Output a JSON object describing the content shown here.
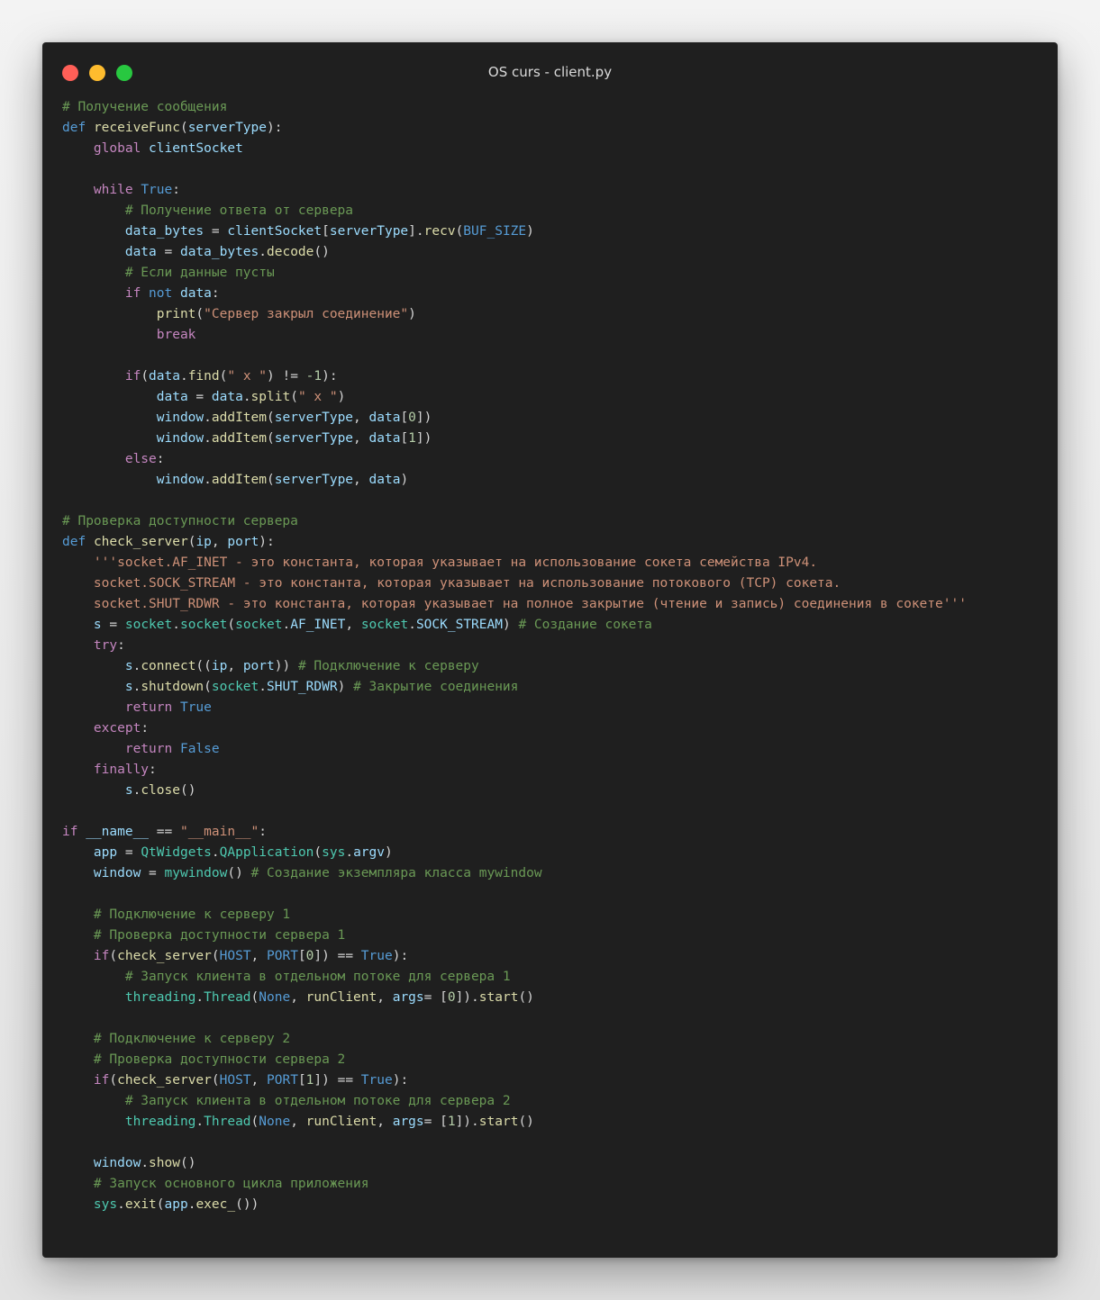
{
  "window": {
    "title": "OS curs - client.py",
    "controls": [
      "close",
      "minimize",
      "maximize"
    ]
  },
  "editor": {
    "language": "python",
    "lines": [
      [
        [
          "com",
          "# Получение сообщения"
        ]
      ],
      [
        [
          "def",
          "def"
        ],
        [
          "plain",
          " "
        ],
        [
          "fn",
          "receiveFunc"
        ],
        [
          "plain",
          "("
        ],
        [
          "var",
          "serverType"
        ],
        [
          "plain",
          "):"
        ]
      ],
      [
        [
          "plain",
          "    "
        ],
        [
          "kw",
          "global"
        ],
        [
          "plain",
          " "
        ],
        [
          "var",
          "clientSocket"
        ]
      ],
      [],
      [
        [
          "plain",
          "    "
        ],
        [
          "kw",
          "while"
        ],
        [
          "plain",
          " "
        ],
        [
          "const",
          "True"
        ],
        [
          "plain",
          ":"
        ]
      ],
      [
        [
          "plain",
          "        "
        ],
        [
          "com",
          "# Получение ответа от сервера"
        ]
      ],
      [
        [
          "plain",
          "        "
        ],
        [
          "var",
          "data_bytes"
        ],
        [
          "plain",
          " = "
        ],
        [
          "var",
          "clientSocket"
        ],
        [
          "plain",
          "["
        ],
        [
          "var",
          "serverType"
        ],
        [
          "plain",
          "]."
        ],
        [
          "fn",
          "recv"
        ],
        [
          "plain",
          "("
        ],
        [
          "const",
          "BUF_SIZE"
        ],
        [
          "plain",
          ")"
        ]
      ],
      [
        [
          "plain",
          "        "
        ],
        [
          "var",
          "data"
        ],
        [
          "plain",
          " = "
        ],
        [
          "var",
          "data_bytes"
        ],
        [
          "plain",
          "."
        ],
        [
          "fn",
          "decode"
        ],
        [
          "plain",
          "()"
        ]
      ],
      [
        [
          "plain",
          "        "
        ],
        [
          "com",
          "# Если данные пусты"
        ]
      ],
      [
        [
          "plain",
          "        "
        ],
        [
          "kw",
          "if"
        ],
        [
          "plain",
          " "
        ],
        [
          "def",
          "not"
        ],
        [
          "plain",
          " "
        ],
        [
          "var",
          "data"
        ],
        [
          "plain",
          ":"
        ]
      ],
      [
        [
          "plain",
          "            "
        ],
        [
          "fn",
          "print"
        ],
        [
          "plain",
          "("
        ],
        [
          "str",
          "\"Сервер закрыл соединение\""
        ],
        [
          "plain",
          ")"
        ]
      ],
      [
        [
          "plain",
          "            "
        ],
        [
          "kw",
          "break"
        ]
      ],
      [],
      [
        [
          "plain",
          "        "
        ],
        [
          "kw",
          "if"
        ],
        [
          "plain",
          "("
        ],
        [
          "var",
          "data"
        ],
        [
          "plain",
          "."
        ],
        [
          "fn",
          "find"
        ],
        [
          "plain",
          "("
        ],
        [
          "str",
          "\" x \""
        ],
        [
          "plain",
          ") != "
        ],
        [
          "num",
          "-1"
        ],
        [
          "plain",
          "):"
        ]
      ],
      [
        [
          "plain",
          "            "
        ],
        [
          "var",
          "data"
        ],
        [
          "plain",
          " = "
        ],
        [
          "var",
          "data"
        ],
        [
          "plain",
          "."
        ],
        [
          "fn",
          "split"
        ],
        [
          "plain",
          "("
        ],
        [
          "str",
          "\" x \""
        ],
        [
          "plain",
          ")"
        ]
      ],
      [
        [
          "plain",
          "            "
        ],
        [
          "var",
          "window"
        ],
        [
          "plain",
          "."
        ],
        [
          "fn",
          "addItem"
        ],
        [
          "plain",
          "("
        ],
        [
          "var",
          "serverType"
        ],
        [
          "plain",
          ", "
        ],
        [
          "var",
          "data"
        ],
        [
          "plain",
          "["
        ],
        [
          "num",
          "0"
        ],
        [
          "plain",
          "])"
        ]
      ],
      [
        [
          "plain",
          "            "
        ],
        [
          "var",
          "window"
        ],
        [
          "plain",
          "."
        ],
        [
          "fn",
          "addItem"
        ],
        [
          "plain",
          "("
        ],
        [
          "var",
          "serverType"
        ],
        [
          "plain",
          ", "
        ],
        [
          "var",
          "data"
        ],
        [
          "plain",
          "["
        ],
        [
          "num",
          "1"
        ],
        [
          "plain",
          "])"
        ]
      ],
      [
        [
          "plain",
          "        "
        ],
        [
          "kw",
          "else"
        ],
        [
          "plain",
          ":"
        ]
      ],
      [
        [
          "plain",
          "            "
        ],
        [
          "var",
          "window"
        ],
        [
          "plain",
          "."
        ],
        [
          "fn",
          "addItem"
        ],
        [
          "plain",
          "("
        ],
        [
          "var",
          "serverType"
        ],
        [
          "plain",
          ", "
        ],
        [
          "var",
          "data"
        ],
        [
          "plain",
          ")"
        ]
      ],
      [],
      [
        [
          "com",
          "# Проверка доступности сервера"
        ]
      ],
      [
        [
          "def",
          "def"
        ],
        [
          "plain",
          " "
        ],
        [
          "fn",
          "check_server"
        ],
        [
          "plain",
          "("
        ],
        [
          "var",
          "ip"
        ],
        [
          "plain",
          ", "
        ],
        [
          "var",
          "port"
        ],
        [
          "plain",
          "):"
        ]
      ],
      [
        [
          "plain",
          "    "
        ],
        [
          "str",
          "'''socket.AF_INET - это константа, которая указывает на использование сокета семейства IPv4."
        ]
      ],
      [
        [
          "plain",
          "    "
        ],
        [
          "str",
          "socket.SOCK_STREAM - это константа, которая указывает на использование потокового (TCP) сокета."
        ]
      ],
      [
        [
          "plain",
          "    "
        ],
        [
          "str",
          "socket.SHUT_RDWR - это константа, которая указывает на полное закрытие (чтение и запись) соединения в сокете'''"
        ]
      ],
      [
        [
          "plain",
          "    "
        ],
        [
          "var",
          "s"
        ],
        [
          "plain",
          " = "
        ],
        [
          "mod",
          "socket"
        ],
        [
          "plain",
          "."
        ],
        [
          "mod",
          "socket"
        ],
        [
          "plain",
          "("
        ],
        [
          "mod",
          "socket"
        ],
        [
          "plain",
          "."
        ],
        [
          "var",
          "AF_INET"
        ],
        [
          "plain",
          ", "
        ],
        [
          "mod",
          "socket"
        ],
        [
          "plain",
          "."
        ],
        [
          "var",
          "SOCK_STREAM"
        ],
        [
          "plain",
          ") "
        ],
        [
          "com",
          "# Создание сокета"
        ]
      ],
      [
        [
          "plain",
          "    "
        ],
        [
          "kw",
          "try"
        ],
        [
          "plain",
          ":"
        ]
      ],
      [
        [
          "plain",
          "        "
        ],
        [
          "var",
          "s"
        ],
        [
          "plain",
          "."
        ],
        [
          "fn",
          "connect"
        ],
        [
          "plain",
          "(("
        ],
        [
          "var",
          "ip"
        ],
        [
          "plain",
          ", "
        ],
        [
          "var",
          "port"
        ],
        [
          "plain",
          ")) "
        ],
        [
          "com",
          "# Подключение к серверу"
        ]
      ],
      [
        [
          "plain",
          "        "
        ],
        [
          "var",
          "s"
        ],
        [
          "plain",
          "."
        ],
        [
          "fn",
          "shutdown"
        ],
        [
          "plain",
          "("
        ],
        [
          "mod",
          "socket"
        ],
        [
          "plain",
          "."
        ],
        [
          "var",
          "SHUT_RDWR"
        ],
        [
          "plain",
          ") "
        ],
        [
          "com",
          "# Закрытие соединения"
        ]
      ],
      [
        [
          "plain",
          "        "
        ],
        [
          "kw",
          "return"
        ],
        [
          "plain",
          " "
        ],
        [
          "const",
          "True"
        ]
      ],
      [
        [
          "plain",
          "    "
        ],
        [
          "kw",
          "except"
        ],
        [
          "plain",
          ":"
        ]
      ],
      [
        [
          "plain",
          "        "
        ],
        [
          "kw",
          "return"
        ],
        [
          "plain",
          " "
        ],
        [
          "const",
          "False"
        ]
      ],
      [
        [
          "plain",
          "    "
        ],
        [
          "kw",
          "finally"
        ],
        [
          "plain",
          ":"
        ]
      ],
      [
        [
          "plain",
          "        "
        ],
        [
          "var",
          "s"
        ],
        [
          "plain",
          "."
        ],
        [
          "fn",
          "close"
        ],
        [
          "plain",
          "()"
        ]
      ],
      [],
      [
        [
          "kw",
          "if"
        ],
        [
          "plain",
          " "
        ],
        [
          "var",
          "__name__"
        ],
        [
          "plain",
          " == "
        ],
        [
          "str",
          "\"__main__\""
        ],
        [
          "plain",
          ":"
        ]
      ],
      [
        [
          "plain",
          "    "
        ],
        [
          "var",
          "app"
        ],
        [
          "plain",
          " = "
        ],
        [
          "mod",
          "QtWidgets"
        ],
        [
          "plain",
          "."
        ],
        [
          "mod",
          "QApplication"
        ],
        [
          "plain",
          "("
        ],
        [
          "mod",
          "sys"
        ],
        [
          "plain",
          "."
        ],
        [
          "var",
          "argv"
        ],
        [
          "plain",
          ")"
        ]
      ],
      [
        [
          "plain",
          "    "
        ],
        [
          "var",
          "window"
        ],
        [
          "plain",
          " = "
        ],
        [
          "mod",
          "mywindow"
        ],
        [
          "plain",
          "() "
        ],
        [
          "com",
          "# Создание экземпляра класса mywindow"
        ]
      ],
      [],
      [
        [
          "plain",
          "    "
        ],
        [
          "com",
          "# Подключение к серверу 1"
        ]
      ],
      [
        [
          "plain",
          "    "
        ],
        [
          "com",
          "# Проверка доступности сервера 1"
        ]
      ],
      [
        [
          "plain",
          "    "
        ],
        [
          "kw",
          "if"
        ],
        [
          "plain",
          "("
        ],
        [
          "fn",
          "check_server"
        ],
        [
          "plain",
          "("
        ],
        [
          "const",
          "HOST"
        ],
        [
          "plain",
          ", "
        ],
        [
          "const",
          "PORT"
        ],
        [
          "plain",
          "["
        ],
        [
          "num",
          "0"
        ],
        [
          "plain",
          "]) == "
        ],
        [
          "const",
          "True"
        ],
        [
          "plain",
          "):"
        ]
      ],
      [
        [
          "plain",
          "        "
        ],
        [
          "com",
          "# Запуск клиента в отдельном потоке для сервера 1"
        ]
      ],
      [
        [
          "plain",
          "        "
        ],
        [
          "mod",
          "threading"
        ],
        [
          "plain",
          "."
        ],
        [
          "mod",
          "Thread"
        ],
        [
          "plain",
          "("
        ],
        [
          "const",
          "None"
        ],
        [
          "plain",
          ", "
        ],
        [
          "fn",
          "runClient"
        ],
        [
          "plain",
          ", "
        ],
        [
          "var",
          "args"
        ],
        [
          "plain",
          "= ["
        ],
        [
          "num",
          "0"
        ],
        [
          "plain",
          "])."
        ],
        [
          "fn",
          "start"
        ],
        [
          "plain",
          "()"
        ]
      ],
      [],
      [
        [
          "plain",
          "    "
        ],
        [
          "com",
          "# Подключение к серверу 2"
        ]
      ],
      [
        [
          "plain",
          "    "
        ],
        [
          "com",
          "# Проверка доступности сервера 2"
        ]
      ],
      [
        [
          "plain",
          "    "
        ],
        [
          "kw",
          "if"
        ],
        [
          "plain",
          "("
        ],
        [
          "fn",
          "check_server"
        ],
        [
          "plain",
          "("
        ],
        [
          "const",
          "HOST"
        ],
        [
          "plain",
          ", "
        ],
        [
          "const",
          "PORT"
        ],
        [
          "plain",
          "["
        ],
        [
          "num",
          "1"
        ],
        [
          "plain",
          "]) == "
        ],
        [
          "const",
          "True"
        ],
        [
          "plain",
          "):"
        ]
      ],
      [
        [
          "plain",
          "        "
        ],
        [
          "com",
          "# Запуск клиента в отдельном потоке для сервера 2"
        ]
      ],
      [
        [
          "plain",
          "        "
        ],
        [
          "mod",
          "threading"
        ],
        [
          "plain",
          "."
        ],
        [
          "mod",
          "Thread"
        ],
        [
          "plain",
          "("
        ],
        [
          "const",
          "None"
        ],
        [
          "plain",
          ", "
        ],
        [
          "fn",
          "runClient"
        ],
        [
          "plain",
          ", "
        ],
        [
          "var",
          "args"
        ],
        [
          "plain",
          "= ["
        ],
        [
          "num",
          "1"
        ],
        [
          "plain",
          "])."
        ],
        [
          "fn",
          "start"
        ],
        [
          "plain",
          "()"
        ]
      ],
      [],
      [
        [
          "plain",
          "    "
        ],
        [
          "var",
          "window"
        ],
        [
          "plain",
          "."
        ],
        [
          "fn",
          "show"
        ],
        [
          "plain",
          "()"
        ]
      ],
      [
        [
          "plain",
          "    "
        ],
        [
          "com",
          "# Запуск основного цикла приложения"
        ]
      ],
      [
        [
          "plain",
          "    "
        ],
        [
          "mod",
          "sys"
        ],
        [
          "plain",
          "."
        ],
        [
          "fn",
          "exit"
        ],
        [
          "plain",
          "("
        ],
        [
          "var",
          "app"
        ],
        [
          "plain",
          "."
        ],
        [
          "fn",
          "exec_"
        ],
        [
          "plain",
          "())"
        ]
      ]
    ]
  }
}
